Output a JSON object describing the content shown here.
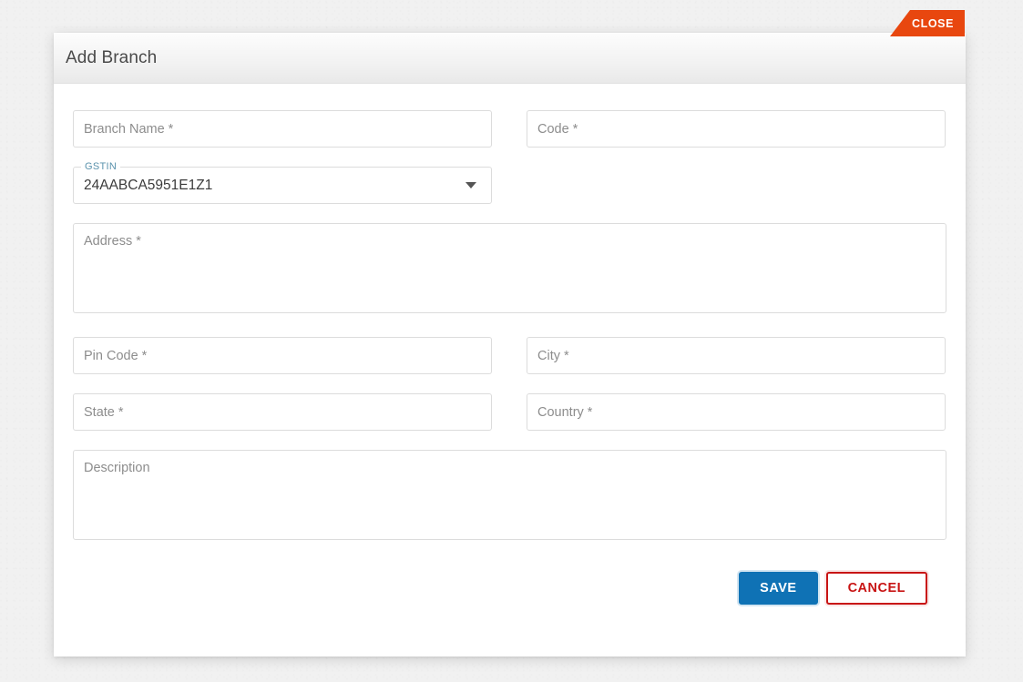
{
  "close_tab": {
    "label": "CLOSE"
  },
  "dialog": {
    "title": "Add Branch"
  },
  "form": {
    "branch_name": {
      "placeholder": "Branch Name *",
      "value": ""
    },
    "code": {
      "placeholder": "Code *",
      "value": ""
    },
    "gstin": {
      "label": "GSTIN",
      "selected": "24AABCA5951E1Z1",
      "caret_icon": "chevron-down-icon"
    },
    "address": {
      "placeholder": "Address *",
      "value": ""
    },
    "pin_code": {
      "placeholder": "Pin Code *",
      "value": ""
    },
    "city": {
      "placeholder": "City *",
      "value": ""
    },
    "state": {
      "placeholder": "State *",
      "value": ""
    },
    "country": {
      "placeholder": "Country *",
      "value": ""
    },
    "description": {
      "placeholder": "Description",
      "value": ""
    }
  },
  "footer": {
    "save_label": "SAVE",
    "cancel_label": "CANCEL"
  },
  "colors": {
    "close_ribbon": "#e8470f",
    "save_button": "#0f72b5",
    "cancel_button": "#c81414",
    "gstin_label": "#5b93ad",
    "page_background": "#f1f1f1"
  }
}
